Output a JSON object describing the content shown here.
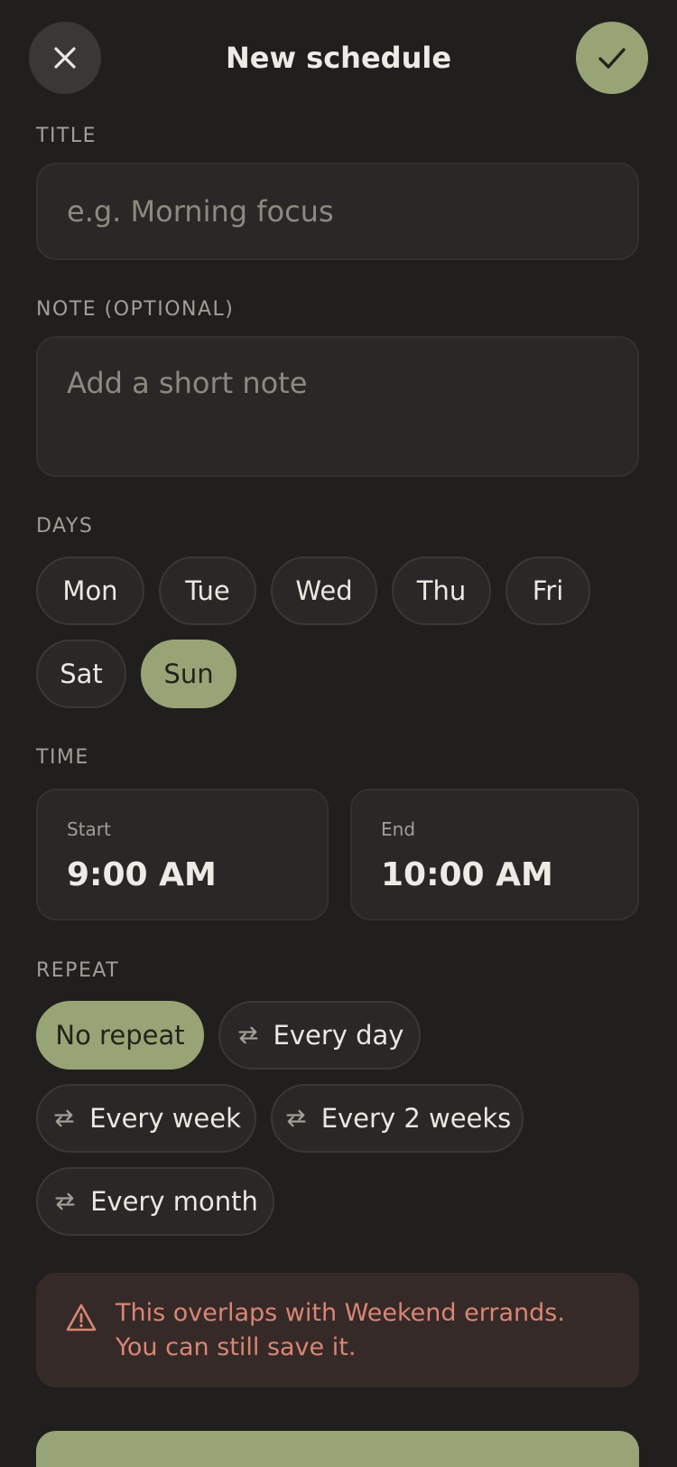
{
  "header": {
    "title": "New schedule",
    "close_icon": "close-icon",
    "confirm_icon": "check-icon"
  },
  "title_field": {
    "label": "TITLE",
    "placeholder": "e.g. Morning focus",
    "value": ""
  },
  "note_field": {
    "label": "NOTE (OPTIONAL)",
    "placeholder": "Add a short note",
    "value": ""
  },
  "days": {
    "label": "DAYS",
    "items": [
      {
        "label": "Mon",
        "selected": false
      },
      {
        "label": "Tue",
        "selected": false
      },
      {
        "label": "Wed",
        "selected": false
      },
      {
        "label": "Thu",
        "selected": false
      },
      {
        "label": "Fri",
        "selected": false
      },
      {
        "label": "Sat",
        "selected": false
      },
      {
        "label": "Sun",
        "selected": true
      }
    ]
  },
  "time": {
    "label": "TIME",
    "start": {
      "label": "Start",
      "value": "9:00 AM"
    },
    "end": {
      "label": "End",
      "value": "10:00 AM"
    }
  },
  "repeat": {
    "label": "REPEAT",
    "options": [
      {
        "label": "No repeat",
        "selected": true,
        "icon": ""
      },
      {
        "label": "Every day",
        "selected": false,
        "icon": "repeat-icon"
      },
      {
        "label": "Every week",
        "selected": false,
        "icon": "repeat-icon"
      },
      {
        "label": "Every 2 weeks",
        "selected": false,
        "icon": "repeat-icon"
      },
      {
        "label": "Every month",
        "selected": false,
        "icon": "repeat-icon"
      }
    ]
  },
  "warning": {
    "icon": "warning-icon",
    "text": "This overlaps with Weekend errands. You can still save it."
  },
  "colors": {
    "background": "#211f1e",
    "accent": "#99a476",
    "warning_text": "#d98674",
    "warning_bg": "#362a28"
  }
}
